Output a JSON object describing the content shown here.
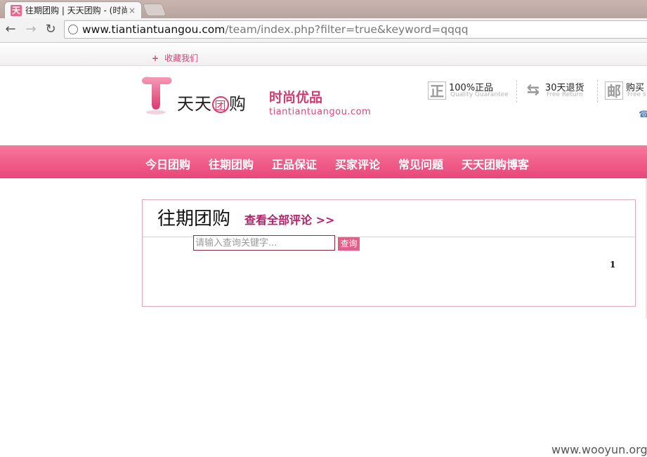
{
  "browser": {
    "tab_title": "往期团购 | 天天团购 - (时尚",
    "tab_favicon": "天",
    "close_glyph": "×",
    "back_glyph": "←",
    "forward_glyph": "→",
    "reload_glyph": "↻",
    "url_host": "www.tiantiantuangou.com",
    "url_path": "/team/index.php?filter=true&keyword=qqqq"
  },
  "topbar": {
    "plus": "+",
    "favorite_label": "收藏我们"
  },
  "header": {
    "logo_text_before": "天天",
    "logo_circle_char": "团",
    "logo_text_after": "购",
    "slogan": "时尚优品",
    "domain": "tiantiantuangou.com",
    "badges": [
      {
        "icon_char": "正",
        "title": "100%正品",
        "subtitle": "Quality Guarantee"
      },
      {
        "icon_char": "⇆",
        "title": "30天退货",
        "subtitle": "Free Return"
      },
      {
        "icon_char": "邮",
        "title": "购买",
        "subtitle": "Free s"
      }
    ],
    "phone_icon": "☎"
  },
  "nav": {
    "items": [
      "今日团购",
      "往期团购",
      "正品保证",
      "买家评论",
      "常见问题",
      "天天团购博客"
    ]
  },
  "main": {
    "title": "往期团购",
    "view_all_link": "查看全部评论 >>",
    "search_placeholder": "请输入查询关键字...",
    "search_button": "查询",
    "page_number": "1"
  },
  "watermark": "www.wooyun.org",
  "colors": {
    "brand_pink": "#e8467a",
    "link_magenta": "#b3236a"
  }
}
